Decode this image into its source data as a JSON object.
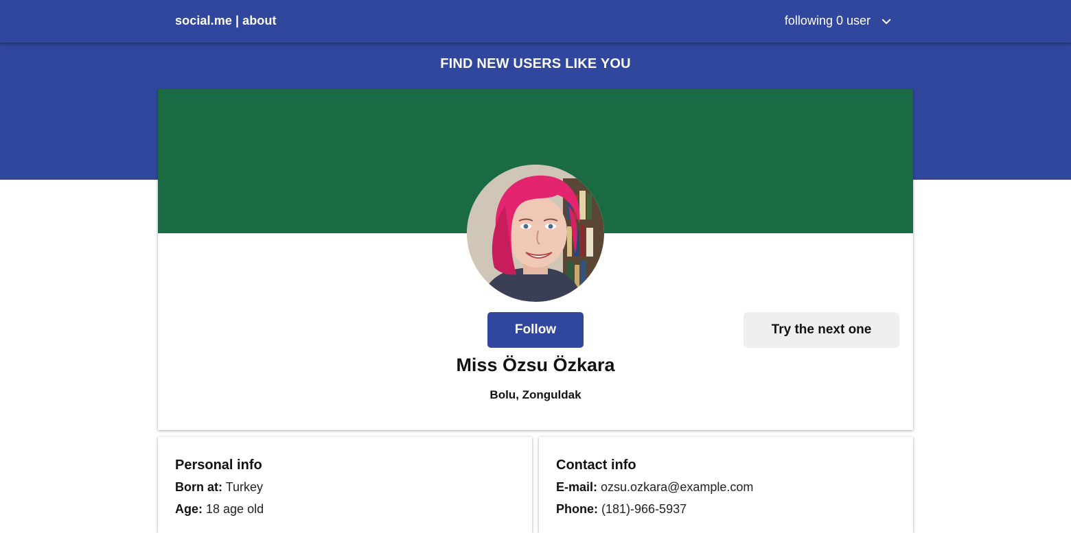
{
  "nav": {
    "brand": "social.me",
    "separator": "|",
    "about": "about",
    "following_label": "following 0 user",
    "dropdown_icon": "chevron-down-icon"
  },
  "hero": {
    "title": "FIND NEW USERS LIKE YOU"
  },
  "profile": {
    "banner_color": "#1a6b44",
    "avatar_alt": "Miss Özsu Özkara",
    "follow_label": "Follow",
    "next_label": "Try the next one",
    "name": "Miss Özsu Özkara",
    "location": "Bolu, Zonguldak"
  },
  "personal_info": {
    "title": "Personal info",
    "born_label": "Born at:",
    "born_value": "Turkey",
    "age_label": "Age:",
    "age_value": "18 age old"
  },
  "contact_info": {
    "title": "Contact info",
    "email_label": "E-mail:",
    "email_value": "ozsu.ozkara@example.com",
    "phone_label": "Phone:",
    "phone_value": "(181)-966-5937"
  },
  "colors": {
    "primary": "#31479e",
    "banner": "#1a6b44",
    "secondary_button": "#efefef"
  }
}
